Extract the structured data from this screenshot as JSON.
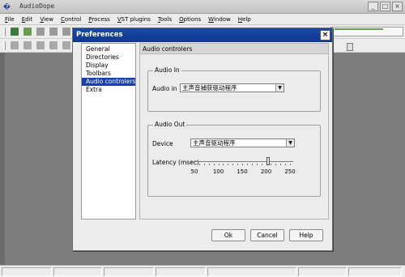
{
  "app": {
    "icon_text": "�",
    "title": "AudioDope",
    "window_buttons": [
      "_",
      "□",
      "×"
    ]
  },
  "menubar": [
    {
      "key": "F",
      "rest": "ile"
    },
    {
      "key": "E",
      "rest": "dit"
    },
    {
      "key": "V",
      "rest": "iew"
    },
    {
      "key": "C",
      "rest": "ontrol"
    },
    {
      "key": "P",
      "rest": "rocess"
    },
    {
      "key": "V",
      "rest": "ST plugins"
    },
    {
      "key": "T",
      "rest": "ools"
    },
    {
      "key": "O",
      "rest": "ptions"
    },
    {
      "key": "W",
      "rest": "indow"
    },
    {
      "key": "H",
      "rest": "elp"
    }
  ],
  "dialog": {
    "title": "Preferences",
    "close_label": "×",
    "nav_items": [
      "General",
      "Directories",
      "Display",
      "Toolbars",
      "Audio controlers",
      "Extra"
    ],
    "selected_nav": "Audio controlers",
    "panel_title": "Audio controlers",
    "audio_in": {
      "group_title": "Audio In",
      "label": "Audio in",
      "value": "主声音捕获驱动程序"
    },
    "audio_out": {
      "group_title": "Audio Out",
      "device_label": "Device",
      "device_value": "主声音驱动程序",
      "latency_label": "Latency (msec)",
      "latency_ticks": [
        "50",
        "100",
        "150",
        "200",
        "250"
      ],
      "latency_value": 205,
      "latency_range": [
        50,
        250
      ]
    },
    "buttons": {
      "ok": "Ok",
      "cancel": "Cancel",
      "help": "Help"
    }
  }
}
